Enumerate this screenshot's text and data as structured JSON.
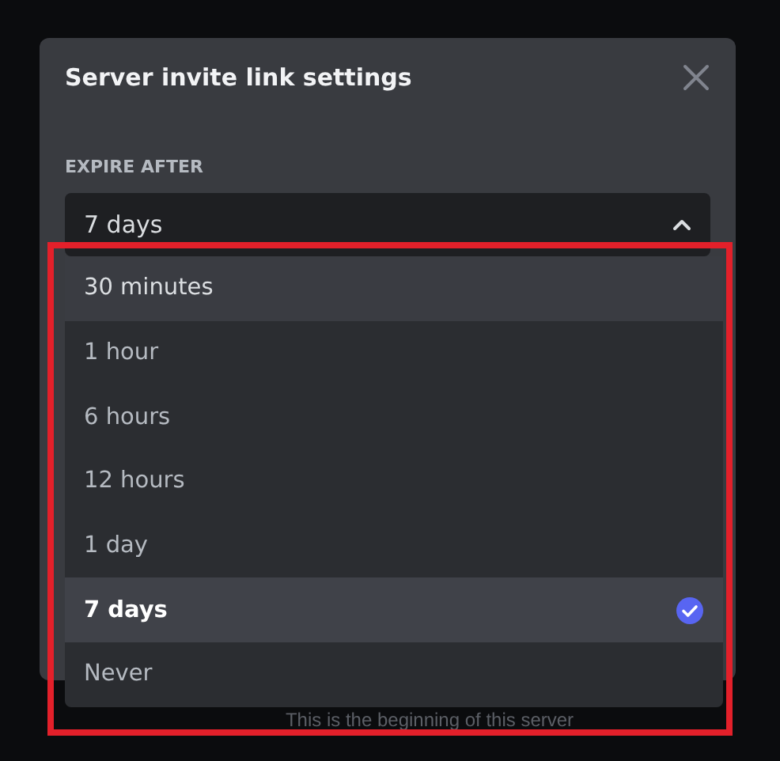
{
  "dialog": {
    "title": "Server invite link settings",
    "field_label": "EXPIRE AFTER",
    "select": {
      "value": "7 days",
      "expanded": true
    },
    "options": [
      {
        "label": "30 minutes",
        "highlighted": true,
        "selected": false
      },
      {
        "label": "1 hour",
        "highlighted": false,
        "selected": false
      },
      {
        "label": "6 hours",
        "highlighted": false,
        "selected": false
      },
      {
        "label": "12 hours",
        "highlighted": false,
        "selected": false
      },
      {
        "label": "1 day",
        "highlighted": false,
        "selected": false
      },
      {
        "label": "7 days",
        "highlighted": false,
        "selected": true
      },
      {
        "label": "Never",
        "highlighted": false,
        "selected": false
      }
    ]
  },
  "background_text": "This is the beginning of this server"
}
